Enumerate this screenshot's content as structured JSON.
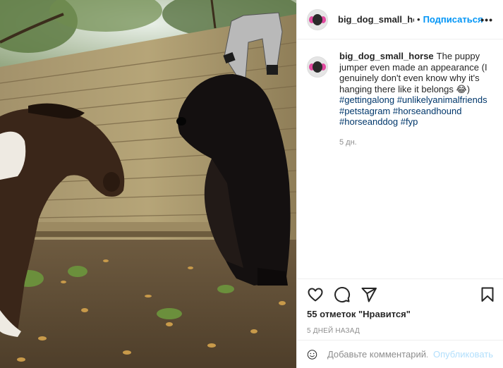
{
  "post": {
    "username": "big_dog_small_horse",
    "dot": "•",
    "follow_label": "Подписаться",
    "more_label": "•••"
  },
  "caption": {
    "username": "big_dog_small_horse",
    "text": "The puppy jumper even made an appearance (I genuinely don't even know why it's hanging there like it belongs 😂)",
    "hashtags": [
      "#gettingalong",
      "#unlikelyanimalfriends",
      "#petstagram",
      "#horseandhound",
      "#horseanddog",
      "#fyp"
    ],
    "time": "5 дн."
  },
  "actions": {
    "icons": [
      "heart-icon",
      "comment-icon",
      "share-icon",
      "bookmark-icon"
    ],
    "likes": "55 отметок \"Нравится\"",
    "date": "5 ДНЕЙ НАЗАД"
  },
  "comment_box": {
    "placeholder": "Добавьте комментарий...",
    "publish_label": "Опубликовать"
  },
  "colors": {
    "accent": "#0095f6",
    "publish_disabled": "#b2dffc",
    "hashtag": "#00376b",
    "muted": "#8e8e8e"
  }
}
